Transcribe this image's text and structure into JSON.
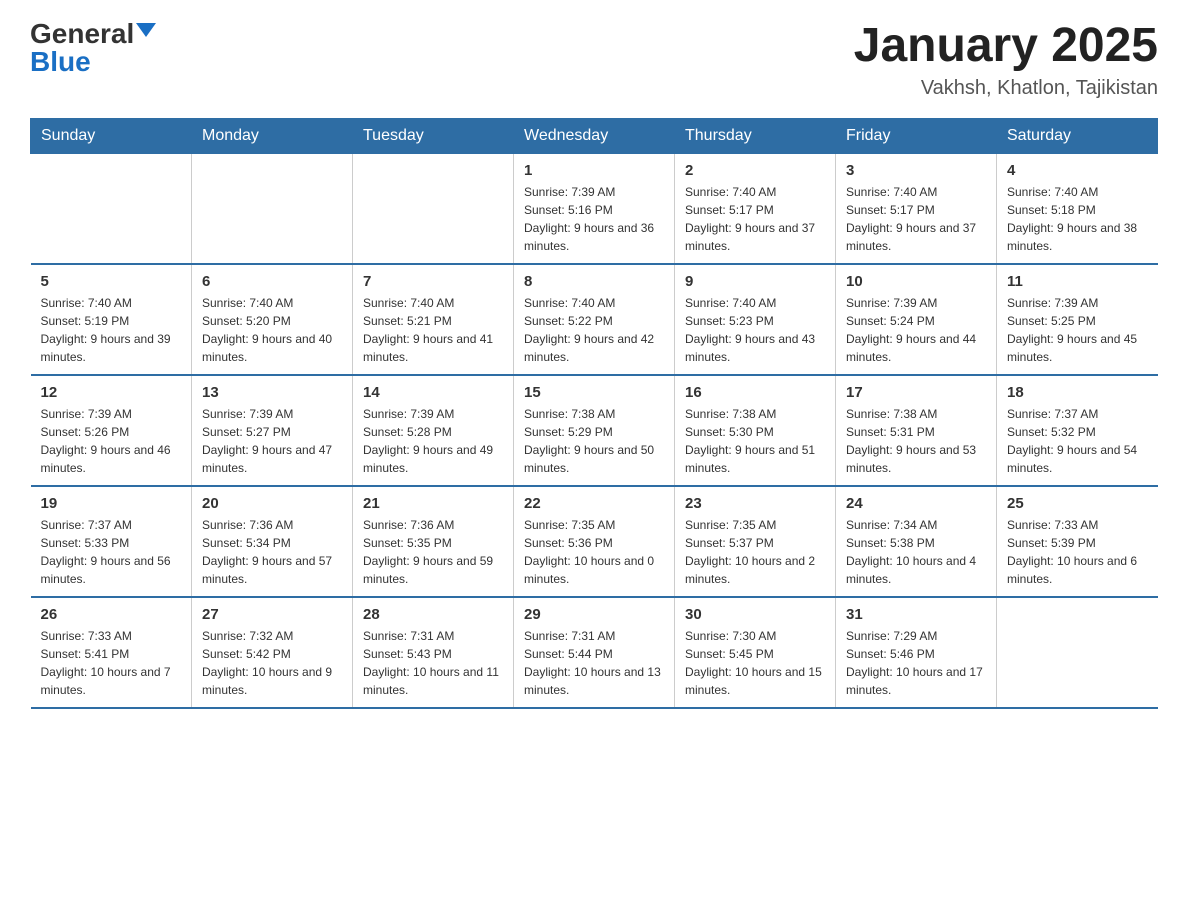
{
  "logo": {
    "general": "General",
    "blue": "Blue"
  },
  "title": {
    "month_year": "January 2025",
    "location": "Vakhsh, Khatlon, Tajikistan"
  },
  "header_days": [
    "Sunday",
    "Monday",
    "Tuesday",
    "Wednesday",
    "Thursday",
    "Friday",
    "Saturday"
  ],
  "weeks": [
    [
      {
        "day": "",
        "info": ""
      },
      {
        "day": "",
        "info": ""
      },
      {
        "day": "",
        "info": ""
      },
      {
        "day": "1",
        "info": "Sunrise: 7:39 AM\nSunset: 5:16 PM\nDaylight: 9 hours and 36 minutes."
      },
      {
        "day": "2",
        "info": "Sunrise: 7:40 AM\nSunset: 5:17 PM\nDaylight: 9 hours and 37 minutes."
      },
      {
        "day": "3",
        "info": "Sunrise: 7:40 AM\nSunset: 5:17 PM\nDaylight: 9 hours and 37 minutes."
      },
      {
        "day": "4",
        "info": "Sunrise: 7:40 AM\nSunset: 5:18 PM\nDaylight: 9 hours and 38 minutes."
      }
    ],
    [
      {
        "day": "5",
        "info": "Sunrise: 7:40 AM\nSunset: 5:19 PM\nDaylight: 9 hours and 39 minutes."
      },
      {
        "day": "6",
        "info": "Sunrise: 7:40 AM\nSunset: 5:20 PM\nDaylight: 9 hours and 40 minutes."
      },
      {
        "day": "7",
        "info": "Sunrise: 7:40 AM\nSunset: 5:21 PM\nDaylight: 9 hours and 41 minutes."
      },
      {
        "day": "8",
        "info": "Sunrise: 7:40 AM\nSunset: 5:22 PM\nDaylight: 9 hours and 42 minutes."
      },
      {
        "day": "9",
        "info": "Sunrise: 7:40 AM\nSunset: 5:23 PM\nDaylight: 9 hours and 43 minutes."
      },
      {
        "day": "10",
        "info": "Sunrise: 7:39 AM\nSunset: 5:24 PM\nDaylight: 9 hours and 44 minutes."
      },
      {
        "day": "11",
        "info": "Sunrise: 7:39 AM\nSunset: 5:25 PM\nDaylight: 9 hours and 45 minutes."
      }
    ],
    [
      {
        "day": "12",
        "info": "Sunrise: 7:39 AM\nSunset: 5:26 PM\nDaylight: 9 hours and 46 minutes."
      },
      {
        "day": "13",
        "info": "Sunrise: 7:39 AM\nSunset: 5:27 PM\nDaylight: 9 hours and 47 minutes."
      },
      {
        "day": "14",
        "info": "Sunrise: 7:39 AM\nSunset: 5:28 PM\nDaylight: 9 hours and 49 minutes."
      },
      {
        "day": "15",
        "info": "Sunrise: 7:38 AM\nSunset: 5:29 PM\nDaylight: 9 hours and 50 minutes."
      },
      {
        "day": "16",
        "info": "Sunrise: 7:38 AM\nSunset: 5:30 PM\nDaylight: 9 hours and 51 minutes."
      },
      {
        "day": "17",
        "info": "Sunrise: 7:38 AM\nSunset: 5:31 PM\nDaylight: 9 hours and 53 minutes."
      },
      {
        "day": "18",
        "info": "Sunrise: 7:37 AM\nSunset: 5:32 PM\nDaylight: 9 hours and 54 minutes."
      }
    ],
    [
      {
        "day": "19",
        "info": "Sunrise: 7:37 AM\nSunset: 5:33 PM\nDaylight: 9 hours and 56 minutes."
      },
      {
        "day": "20",
        "info": "Sunrise: 7:36 AM\nSunset: 5:34 PM\nDaylight: 9 hours and 57 minutes."
      },
      {
        "day": "21",
        "info": "Sunrise: 7:36 AM\nSunset: 5:35 PM\nDaylight: 9 hours and 59 minutes."
      },
      {
        "day": "22",
        "info": "Sunrise: 7:35 AM\nSunset: 5:36 PM\nDaylight: 10 hours and 0 minutes."
      },
      {
        "day": "23",
        "info": "Sunrise: 7:35 AM\nSunset: 5:37 PM\nDaylight: 10 hours and 2 minutes."
      },
      {
        "day": "24",
        "info": "Sunrise: 7:34 AM\nSunset: 5:38 PM\nDaylight: 10 hours and 4 minutes."
      },
      {
        "day": "25",
        "info": "Sunrise: 7:33 AM\nSunset: 5:39 PM\nDaylight: 10 hours and 6 minutes."
      }
    ],
    [
      {
        "day": "26",
        "info": "Sunrise: 7:33 AM\nSunset: 5:41 PM\nDaylight: 10 hours and 7 minutes."
      },
      {
        "day": "27",
        "info": "Sunrise: 7:32 AM\nSunset: 5:42 PM\nDaylight: 10 hours and 9 minutes."
      },
      {
        "day": "28",
        "info": "Sunrise: 7:31 AM\nSunset: 5:43 PM\nDaylight: 10 hours and 11 minutes."
      },
      {
        "day": "29",
        "info": "Sunrise: 7:31 AM\nSunset: 5:44 PM\nDaylight: 10 hours and 13 minutes."
      },
      {
        "day": "30",
        "info": "Sunrise: 7:30 AM\nSunset: 5:45 PM\nDaylight: 10 hours and 15 minutes."
      },
      {
        "day": "31",
        "info": "Sunrise: 7:29 AM\nSunset: 5:46 PM\nDaylight: 10 hours and 17 minutes."
      },
      {
        "day": "",
        "info": ""
      }
    ]
  ]
}
